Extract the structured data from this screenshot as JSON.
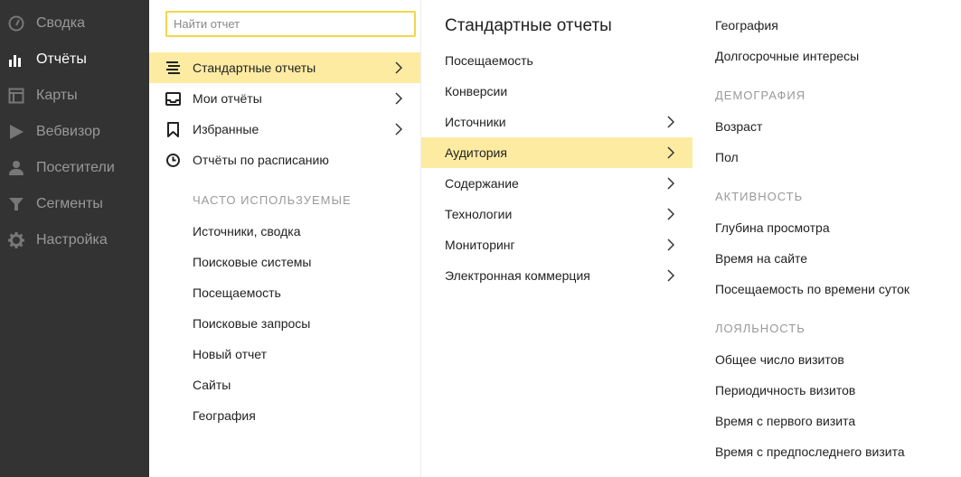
{
  "sidebar": {
    "items": [
      {
        "label": "Сводка",
        "icon": "gauge-icon"
      },
      {
        "label": "Отчёты",
        "icon": "bar-chart-icon",
        "active": true
      },
      {
        "label": "Карты",
        "icon": "map-layout-icon"
      },
      {
        "label": "Вебвизор",
        "icon": "play-icon"
      },
      {
        "label": "Посетители",
        "icon": "user-icon"
      },
      {
        "label": "Сегменты",
        "icon": "funnel-icon"
      },
      {
        "label": "Настройка",
        "icon": "gear-icon"
      }
    ]
  },
  "reports_menu": {
    "search": {
      "placeholder": "Найти отчет",
      "value": ""
    },
    "items": [
      {
        "label": "Стандартные отчеты",
        "icon": "list-icon",
        "selected": true
      },
      {
        "label": "Мои отчёты",
        "icon": "inbox-icon"
      },
      {
        "label": "Избранные",
        "icon": "bookmark-icon"
      },
      {
        "label": "Отчёты по расписанию",
        "icon": "clock-icon"
      }
    ],
    "frequent_title": "ЧАСТО ИСПОЛЬЗУЕМЫЕ",
    "frequent": [
      "Источники, сводка",
      "Поисковые системы",
      "Посещаемость",
      "Поисковые запросы",
      "Новый отчет",
      "Сайты",
      "География"
    ]
  },
  "standard_reports": {
    "title": "Стандартные отчеты",
    "items": [
      {
        "label": "Посещаемость"
      },
      {
        "label": "Конверсии"
      },
      {
        "label": "Источники"
      },
      {
        "label": "Аудитория",
        "selected": true
      },
      {
        "label": "Содержание"
      },
      {
        "label": "Технологии"
      },
      {
        "label": "Мониторинг"
      },
      {
        "label": "Электронная коммерция"
      }
    ]
  },
  "audience": {
    "top": [
      "География",
      "Долгосрочные интересы"
    ],
    "sections": [
      {
        "title": "ДЕМОГРАФИЯ",
        "items": [
          "Возраст",
          "Пол"
        ]
      },
      {
        "title": "АКТИВНОСТЬ",
        "items": [
          "Глубина просмотра",
          "Время на сайте",
          "Посещаемость по времени суток"
        ]
      },
      {
        "title": "ЛОЯЛЬНОСТЬ",
        "items": [
          "Общее число визитов",
          "Периодичность визитов",
          "Время с первого визита",
          "Время с предпоследнего визита"
        ]
      }
    ]
  },
  "colors": {
    "sidebar_bg": "#333333",
    "highlight": "#fdeba2",
    "search_border": "#f0d64a"
  }
}
